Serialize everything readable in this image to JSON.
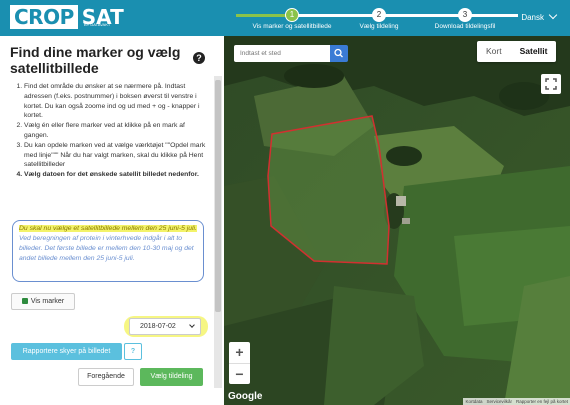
{
  "header": {
    "logo_main": "CROP",
    "logo_accent": "SAT",
    "logo_sub": "BY DATAVAKT",
    "steps": [
      {
        "number": "1",
        "label": "Vis marker og satellitbillede",
        "status": "active"
      },
      {
        "number": "2",
        "label": "Vælg tildeling",
        "status": "pending"
      },
      {
        "number": "3",
        "label": "Download tildelingsfil",
        "status": "pending"
      }
    ],
    "language": "Dansk"
  },
  "sidebar": {
    "title": "Find dine marker og vælg satellitbillede",
    "help_icon": "question-icon",
    "instructions": [
      "Find det område du ønsker at se nærmere på. Indtast adressen (f.eks. postnummer) i boksen øverst til venstre i kortet. Du kan også zoome ind og ud med + og - knapper i kortet.",
      "Vælg én eller flere marker ved at klikke på en mark af gangen.",
      "Du kan opdele marken ved at vælge værktøjet \"\"Opdel mark med linje\"\"\" Når du har valgt marken, skal du klikke på Hent satellitbilleder",
      "Vælg datoen for det ønskede satellit billedet nedenfor."
    ],
    "info_highlight": "Du skal nu vælge et satellitbillede mellem den 25 juni-5 juli.",
    "info_rest": " Ved beregningen af protein i vinterhvede indgår i alt to billeder. Det første billede er mellem den 10-30 maj og det andet billede mellem den 25 juni-5 juli.",
    "vis_marker_label": "Vis marker",
    "date_value": "2018-07-02",
    "report_label": "Rapportere skyer på billedet",
    "report_help": "?",
    "prev_label": "Foregående",
    "next_label": "Vælg tildeling"
  },
  "map": {
    "search_placeholder": "Indtast et sted",
    "map_type": {
      "map_label": "Kort",
      "satellite_label": "Satellit",
      "selected": "Satellit"
    },
    "zoom_in": "+",
    "zoom_out": "−",
    "google_logo": "Google",
    "attribution": [
      "Kortdata",
      "Servicevilkår",
      "Rapporter en fejl på kortet"
    ]
  },
  "colors": {
    "header": "#1a8fb0",
    "step_active": "#8bc34a",
    "primary_button": "#5cb85c",
    "info_button": "#5bc0de",
    "field_outline": "#d23030",
    "highlight": "#f3f36a"
  }
}
